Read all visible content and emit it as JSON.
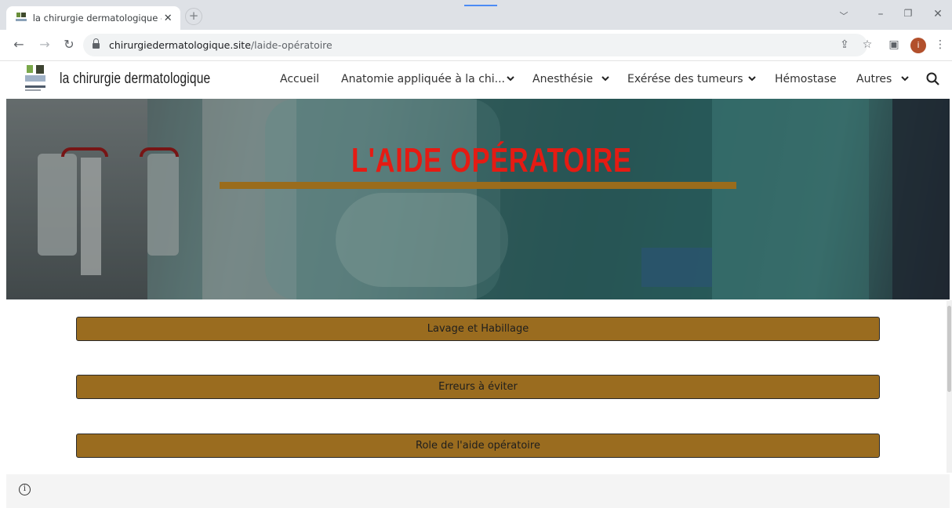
{
  "browser": {
    "tab_title": "la chirurgie dermatologique - L'a",
    "new_tab_label": "+",
    "url_host": "chirurgiedermatologique.site",
    "url_path": "/laide-opératoire",
    "profile_initial": "i"
  },
  "site": {
    "name": "la chirurgie dermatologique",
    "menu": [
      {
        "label": "Accueil",
        "has_dropdown": false
      },
      {
        "label": "Anatomie appliquée à la chi...",
        "has_dropdown": true
      },
      {
        "label": "Anesthésie",
        "has_dropdown": true
      },
      {
        "label": "Exérése des tumeurs",
        "has_dropdown": true
      },
      {
        "label": "Hémostase",
        "has_dropdown": false
      },
      {
        "label": "Autres",
        "has_dropdown": true
      }
    ]
  },
  "hero": {
    "title": "L'AIDE OPÉRATOIRE"
  },
  "sections": [
    {
      "label": "Lavage et Habillage"
    },
    {
      "label": "Erreurs à éviter"
    },
    {
      "label": "Role de l'aide opératoire"
    }
  ],
  "colors": {
    "accent": "#9a6c1f",
    "hero_title": "#e51b13"
  },
  "icons": {
    "info": "info-circle-icon"
  }
}
